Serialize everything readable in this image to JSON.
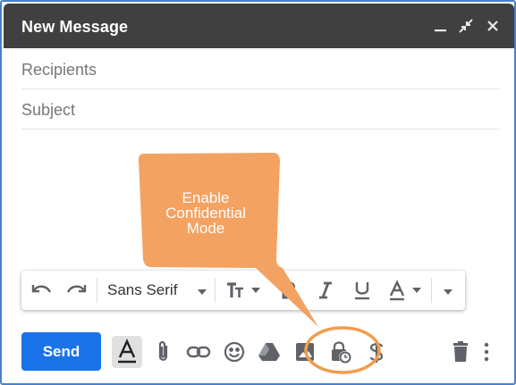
{
  "window": {
    "title": "New Message",
    "controls": [
      "minimize-icon",
      "exit-fullscreen-icon",
      "close-icon"
    ]
  },
  "fields": {
    "recipients_placeholder": "Recipients",
    "subject_placeholder": "Subject"
  },
  "formatting_toolbar": {
    "font_name": "Sans Serif",
    "items": [
      "undo-icon",
      "redo-icon",
      "font-dropdown",
      "text-size-icon",
      "bold-icon",
      "italic-icon",
      "underline-icon",
      "text-color-icon",
      "more-formatting-icon"
    ]
  },
  "bottom_toolbar": {
    "send_label": "Send",
    "items": [
      "formatting-options-icon",
      "attach-icon",
      "link-icon",
      "emoji-icon",
      "drive-icon",
      "photo-icon",
      "confidential-mode-icon",
      "signature-icon",
      "trash-icon",
      "more-options-icon"
    ]
  },
  "callout": {
    "text_line1": "Enable",
    "text_line2": "Confidential",
    "text_line3": "Mode"
  },
  "colors": {
    "titlebar": "#404040",
    "send": "#1a73e8",
    "callout": "#f4a261",
    "highlight_ring": "#f29c4d",
    "frame_border": "#4a7fd0"
  }
}
